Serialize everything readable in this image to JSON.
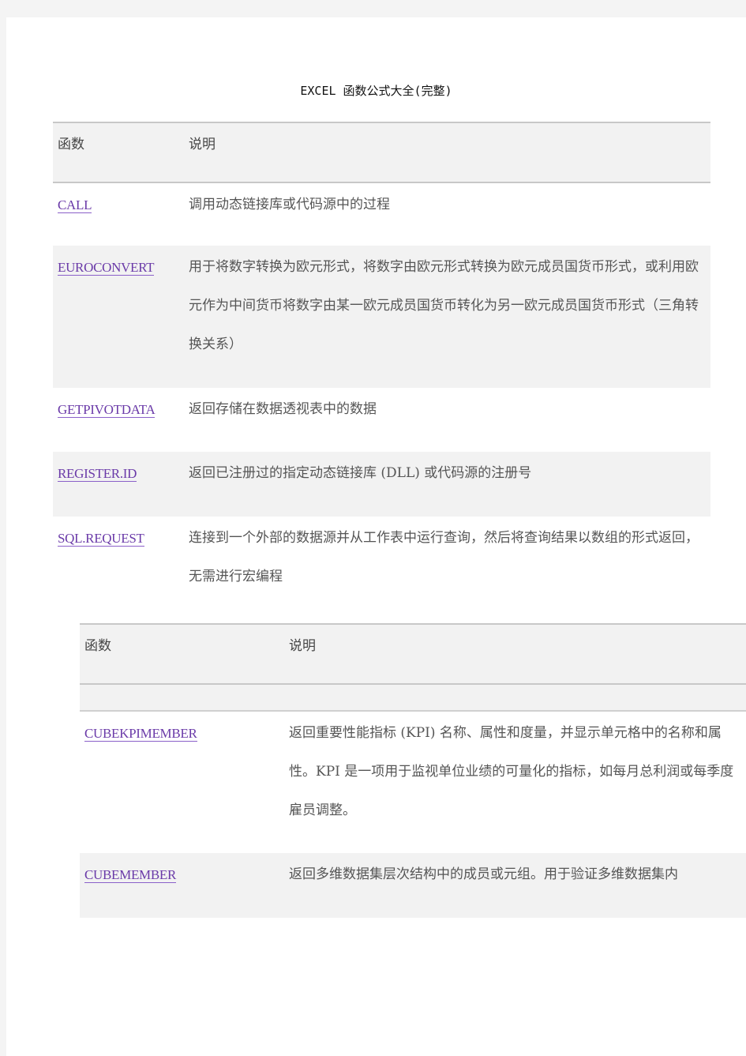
{
  "document": {
    "title": "EXCEL 函数公式大全(完整)"
  },
  "table1": {
    "headers": {
      "function": "函数",
      "description": "说明"
    },
    "rows": [
      {
        "name": "CALL",
        "desc": "调用动态链接库或代码源中的过程"
      },
      {
        "name": "EUROCONVERT",
        "desc": "用于将数字转换为欧元形式，将数字由欧元形式转换为欧元成员国货币形式，或利用欧元作为中间货币将数字由某一欧元成员国货币转化为另一欧元成员国货币形式（三角转换关系）"
      },
      {
        "name": "GETPIVOTDATA",
        "desc": "返回存储在数据透视表中的数据"
      },
      {
        "name": "REGISTER.ID",
        "desc": "返回已注册过的指定动态链接库 (DLL) 或代码源的注册号"
      },
      {
        "name": "SQL.REQUEST",
        "desc": "连接到一个外部的数据源并从工作表中运行查询，然后将查询结果以数组的形式返回，无需进行宏编程"
      }
    ]
  },
  "table2": {
    "headers": {
      "function": "函数",
      "description": "说明"
    },
    "rows": [
      {
        "name": "CUBEKPIMEMBER",
        "desc": "返回重要性能指标 (KPI) 名称、属性和度量，并显示单元格中的名称和属性。KPI 是一项用于监视单位业绩的可量化的指标，如每月总利润或每季度雇员调整。"
      },
      {
        "name": "CUBEMEMBER",
        "desc": "返回多维数据集层次结构中的成员或元组。用于验证多维数据集内"
      }
    ]
  },
  "colors": {
    "link": "#6a3aa8",
    "row_alt": "#f2f2f2",
    "text": "#555555"
  }
}
